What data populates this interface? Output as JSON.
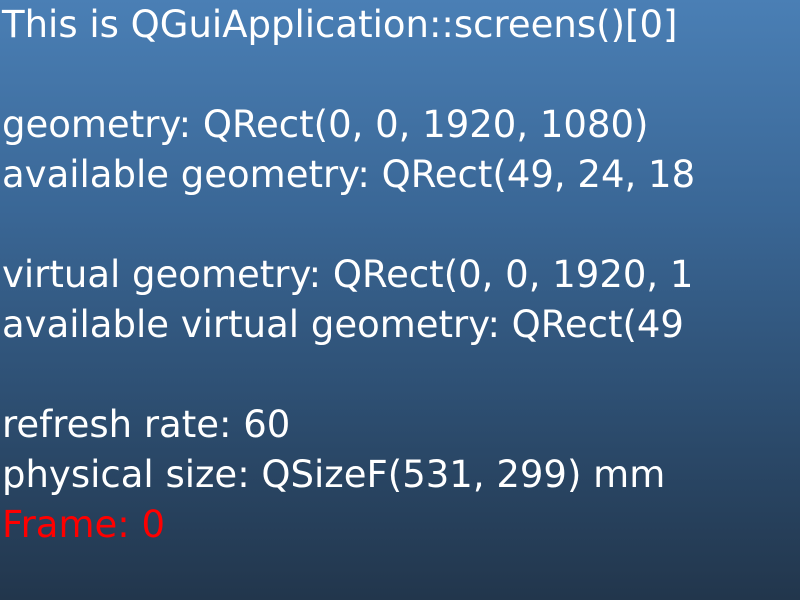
{
  "screen_info": {
    "title": "This is QGuiApplication::screens()[0]",
    "geometry": "geometry: QRect(0, 0, 1920, 1080)",
    "available_geometry": "available geometry: QRect(49, 24, 18",
    "virtual_geometry": "virtual geometry: QRect(0, 0, 1920, 1",
    "available_virtual_geometry": "available virtual geometry: QRect(49",
    "refresh_rate": "refresh rate: 60",
    "physical_size": "physical size: QSizeF(531, 299) mm",
    "frame": "Frame: 0"
  },
  "colors": {
    "text": "#ffffff",
    "frame_text": "#ff0000",
    "background_top": "#4a7fb5",
    "background_bottom": "#22364c"
  }
}
